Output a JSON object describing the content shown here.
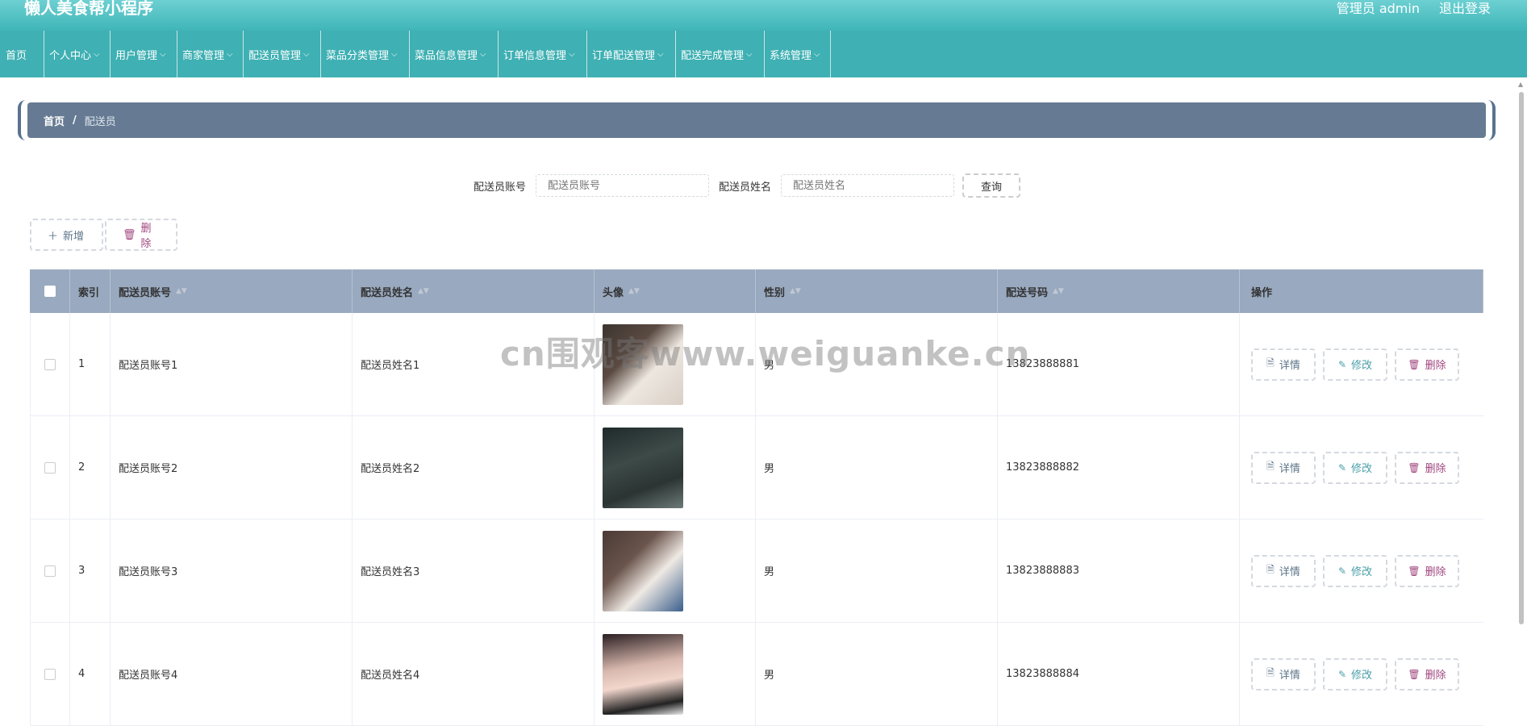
{
  "header": {
    "title": "懒人美食帮小程序",
    "user": "管理员 admin",
    "logout": "退出登录"
  },
  "nav": [
    {
      "label": "首页",
      "chev": false
    },
    {
      "label": "个人中心",
      "chev": true
    },
    {
      "label": "用户管理",
      "chev": true
    },
    {
      "label": "商家管理",
      "chev": true
    },
    {
      "label": "配送员管理",
      "chev": true
    },
    {
      "label": "菜品分类管理",
      "chev": true
    },
    {
      "label": "菜品信息管理",
      "chev": true
    },
    {
      "label": "订单信息管理",
      "chev": true
    },
    {
      "label": "订单配送管理",
      "chev": true
    },
    {
      "label": "配送完成管理",
      "chev": true
    },
    {
      "label": "系统管理",
      "chev": true
    }
  ],
  "breadcrumb": {
    "home": "首页",
    "sep": "/",
    "current": "配送员"
  },
  "search": {
    "account_label": "配送员账号",
    "account_placeholder": "配送员账号",
    "name_label": "配送员姓名",
    "name_placeholder": "配送员姓名",
    "query": "查询"
  },
  "actions": {
    "add": "新增",
    "delete": "删除"
  },
  "table": {
    "columns": [
      "索引",
      "配送员账号",
      "配送员姓名",
      "头像",
      "性别",
      "配送号码",
      "操作"
    ],
    "ops": {
      "detail": "详情",
      "edit": "修改",
      "delete": "删除"
    },
    "rows": [
      {
        "index": "1",
        "account": "配送员账号1",
        "name": "配送员姓名1",
        "gender": "男",
        "phone": "13823888881"
      },
      {
        "index": "2",
        "account": "配送员账号2",
        "name": "配送员姓名2",
        "gender": "男",
        "phone": "13823888882"
      },
      {
        "index": "3",
        "account": "配送员账号3",
        "name": "配送员姓名3",
        "gender": "男",
        "phone": "13823888883"
      },
      {
        "index": "4",
        "account": "配送员账号4",
        "name": "配送员姓名4",
        "gender": "男",
        "phone": "13823888884"
      }
    ]
  },
  "watermark": "cn围观客www.weiguanke.cn",
  "colors": {
    "header": "#3fb5b8",
    "nav": "#3fb0b3",
    "breadcrumb": "#667b93",
    "table_head": "#99a9bf"
  }
}
